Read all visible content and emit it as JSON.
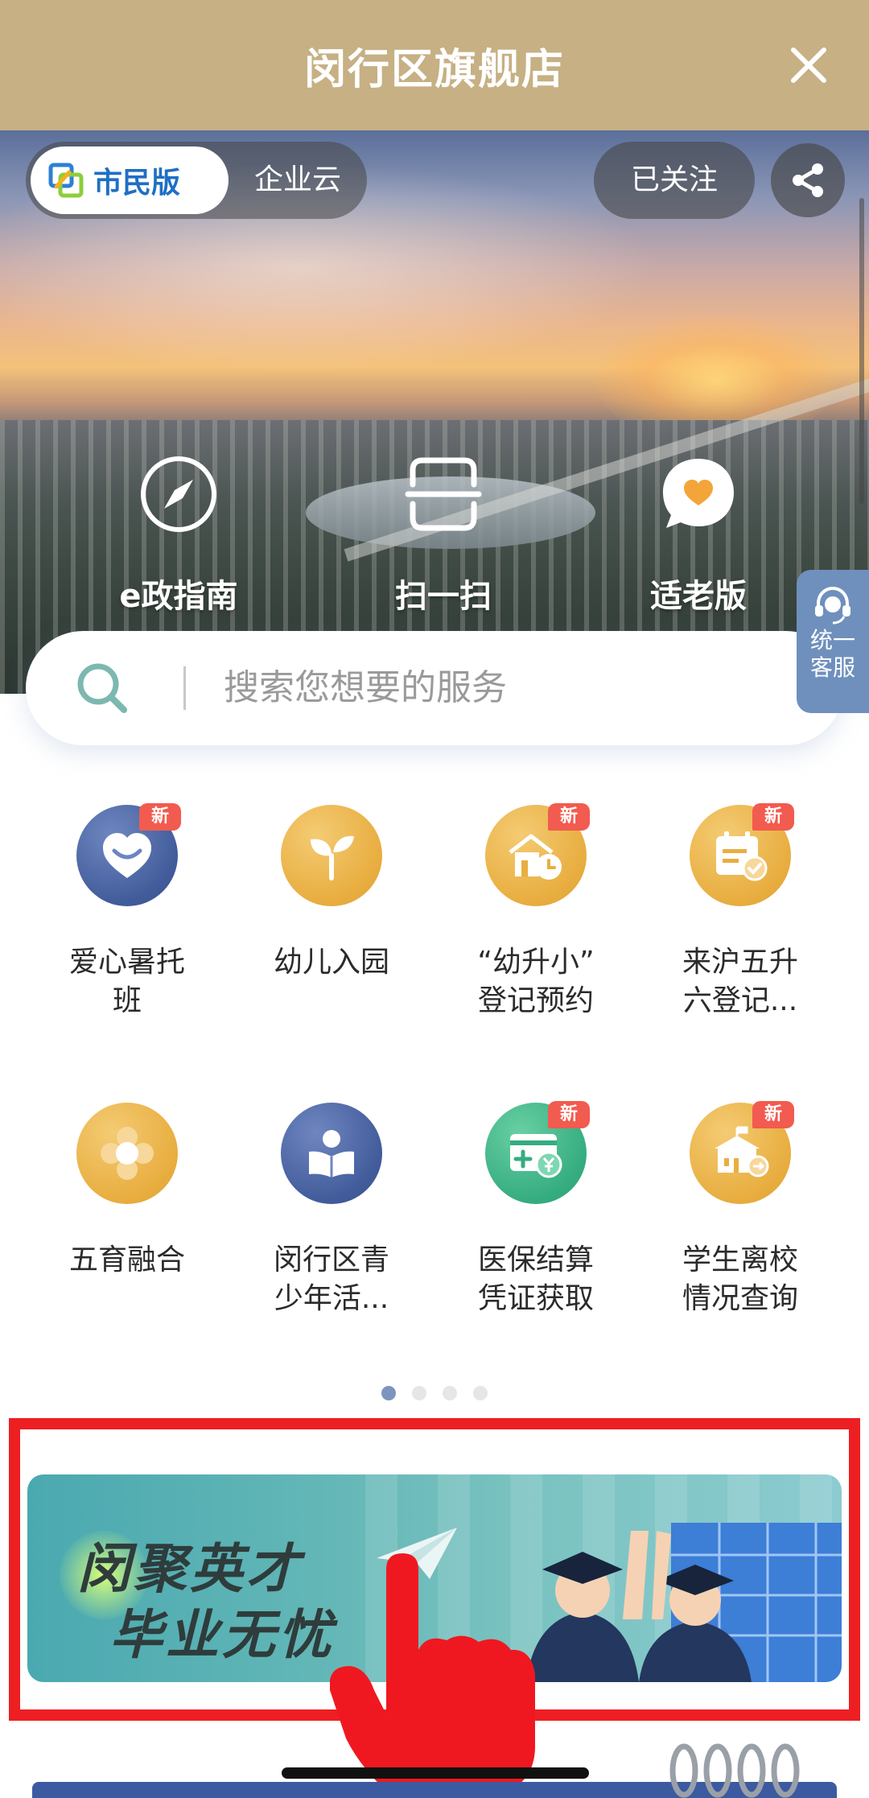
{
  "header": {
    "title": "闵行区旗舰店",
    "close_icon": "close-icon"
  },
  "top_controls": {
    "segments": [
      {
        "label": "市民版",
        "active": true
      },
      {
        "label": "企业云",
        "active": false
      }
    ],
    "follow_label": "已关注",
    "share_icon": "share-icon"
  },
  "hero": {
    "actions": [
      {
        "label": "e政指南",
        "icon": "compass-icon"
      },
      {
        "label": "扫一扫",
        "icon": "scan-icon"
      },
      {
        "label": "适老版",
        "icon": "heart-bubble-icon"
      }
    ]
  },
  "search": {
    "placeholder": "搜索您想要的服务"
  },
  "support": {
    "line1": "统一",
    "line2": "客服"
  },
  "services": [
    {
      "name": "爱心暑托班",
      "line1": "爱心暑托",
      "line2": "班",
      "badge": "新",
      "color": "#4a63a3",
      "icon": "smile-heart-icon"
    },
    {
      "name": "幼儿入园",
      "line1": "幼儿入园",
      "line2": "",
      "badge": "",
      "color": "#e9ae40",
      "icon": "sprout-icon"
    },
    {
      "name": "“幼升小”登记预约",
      "line1": "“幼升小”",
      "line2": "登记预约",
      "badge": "新",
      "color": "#e9ae40",
      "icon": "school-clock-icon"
    },
    {
      "name": "来沪五升六登记...",
      "line1": "来沪五升",
      "line2": "六登记...",
      "badge": "新",
      "color": "#e9ae40",
      "icon": "calendar-check-icon"
    },
    {
      "name": "五育融合",
      "line1": "五育融合",
      "line2": "",
      "badge": "",
      "color": "#e9ae40",
      "icon": "flower-icon"
    },
    {
      "name": "闵行区青少年活...",
      "line1": "闵行区青",
      "line2": "少年活...",
      "badge": "",
      "color": "#4a63a3",
      "icon": "reader-icon"
    },
    {
      "name": "医保结算凭证获取",
      "line1": "医保结算",
      "line2": "凭证获取",
      "badge": "新",
      "color": "#35ad80",
      "icon": "medical-yuan-icon"
    },
    {
      "name": "学生离校情况查询",
      "line1": "学生离校",
      "line2": "情况查询",
      "badge": "新",
      "color": "#e9ae40",
      "icon": "school-exit-icon"
    }
  ],
  "pager": {
    "pages": 4,
    "current": 1
  },
  "banner": {
    "line1": "闵聚英才",
    "line2": "毕业无忧"
  },
  "colors": {
    "header": "#c6b084",
    "accent_blue": "#1f6fc4",
    "highlight_frame": "#ee1f23",
    "badge": "#f25b4f"
  }
}
